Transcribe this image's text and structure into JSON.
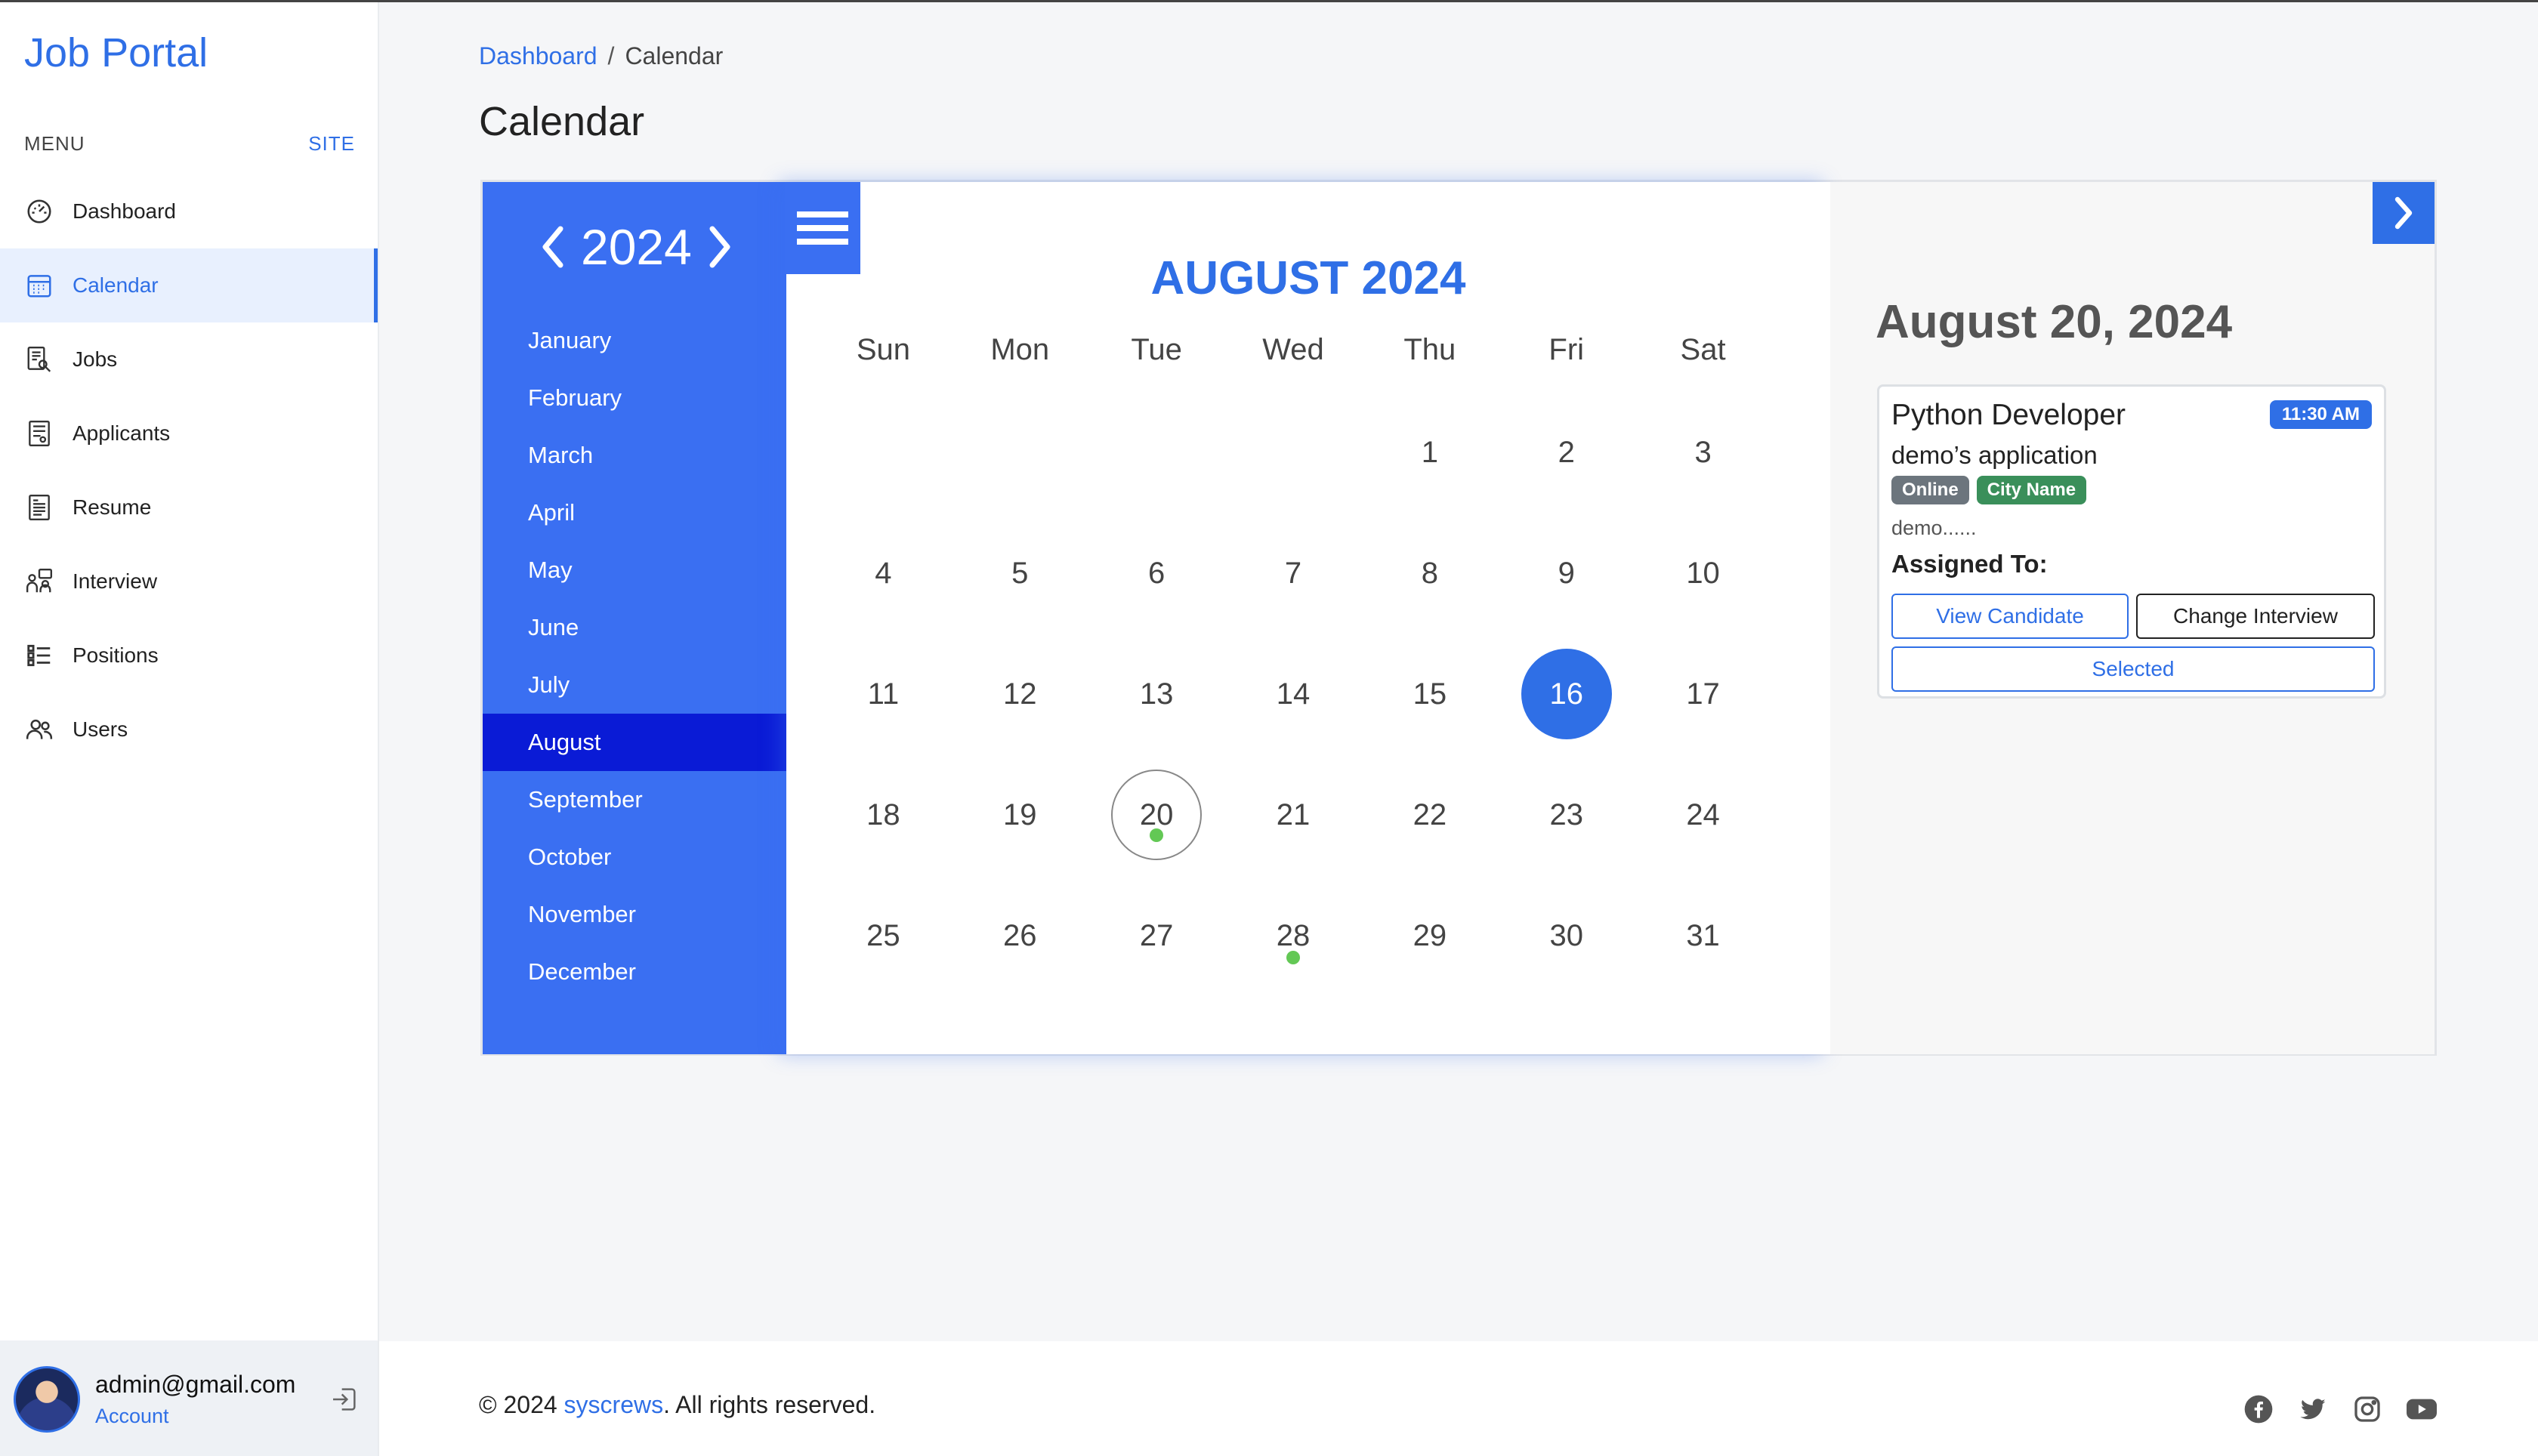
{
  "app": {
    "brand": "Job Portal"
  },
  "sidebar": {
    "menu_label": "MENU",
    "site_label": "SITE",
    "items": [
      {
        "label": "Dashboard",
        "icon": "dashboard-gauge-icon",
        "active": false
      },
      {
        "label": "Calendar",
        "icon": "calendar-icon",
        "active": true
      },
      {
        "label": "Jobs",
        "icon": "jobs-search-icon",
        "active": false
      },
      {
        "label": "Applicants",
        "icon": "applicants-document-icon",
        "active": false
      },
      {
        "label": "Resume",
        "icon": "resume-document-icon",
        "active": false
      },
      {
        "label": "Interview",
        "icon": "interview-people-icon",
        "active": false
      },
      {
        "label": "Positions",
        "icon": "positions-list-icon",
        "active": false
      },
      {
        "label": "Users",
        "icon": "users-icon",
        "active": false
      }
    ],
    "account": {
      "email": "admin@gmail.com",
      "label": "Account"
    }
  },
  "breadcrumb": {
    "link": "Dashboard",
    "separator": "/",
    "current": "Calendar"
  },
  "page_title": "Calendar",
  "calendar": {
    "year": "2024",
    "months": [
      "January",
      "February",
      "March",
      "April",
      "May",
      "June",
      "July",
      "August",
      "September",
      "October",
      "November",
      "December"
    ],
    "active_month": "August",
    "month_title": "AUGUST 2024",
    "weekdays": [
      "Sun",
      "Mon",
      "Tue",
      "Wed",
      "Thu",
      "Fri",
      "Sat"
    ],
    "first_weekday_index": 4,
    "days_in_month": 31,
    "selected_day": 16,
    "focused_day": 20,
    "event_days": [
      20,
      28
    ]
  },
  "detail": {
    "date": "August 20, 2024",
    "event": {
      "title": "Python Developer",
      "time": "11:30 AM",
      "subtitle": "demo’s application",
      "badges": [
        {
          "label": "Online",
          "color": "#6c757d"
        },
        {
          "label": "City Name",
          "color": "#3a8f5a"
        }
      ],
      "description": "demo......",
      "assigned_label": "Assigned To:",
      "view_button": "View Candidate",
      "change_button": "Change Interview",
      "status_button": "Selected"
    }
  },
  "footer": {
    "copyright_prefix": "© 2024 ",
    "company": "syscrews",
    "copyright_suffix": ". All rights reserved.",
    "socials": [
      "facebook-icon",
      "twitter-icon",
      "instagram-icon",
      "youtube-icon"
    ]
  },
  "colors": {
    "accent": "#2f6fe6",
    "panel_blue": "#3a6ff2",
    "active_month": "#0a1bd6",
    "event_dot": "#63c855"
  }
}
